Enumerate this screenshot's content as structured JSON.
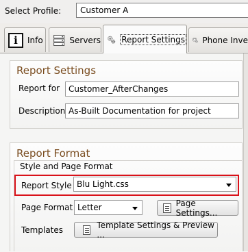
{
  "profile": {
    "label": "Select Profile:",
    "value": "Customer A"
  },
  "tabs": [
    {
      "label": "Info",
      "icon": "info-icon"
    },
    {
      "label": "Servers",
      "icon": "servers-icon"
    },
    {
      "label": "Report Settings",
      "icon": "gears-icon",
      "active": true
    },
    {
      "label": "Phone Inve",
      "icon": "phone-gears-icon"
    }
  ],
  "report_settings": {
    "title": "Report Settings",
    "report_for_label": "Report for",
    "report_for_value": "Customer_AfterChanges",
    "description_label": "Description",
    "description_value": "As-Built Documentation for project"
  },
  "report_format": {
    "title": "Report Format",
    "subgroup_title": "Style and Page Format",
    "report_style_label": "Report Style",
    "report_style_value": "Blu Light.css",
    "page_format_label": "Page Format",
    "page_format_value": "Letter",
    "page_settings_button": "Page Settings...",
    "templates_label": "Templates",
    "template_settings_button": "Template Settings & Preview ..."
  },
  "colors": {
    "group_title": "#7a4d20",
    "highlight": "#d9121a"
  }
}
